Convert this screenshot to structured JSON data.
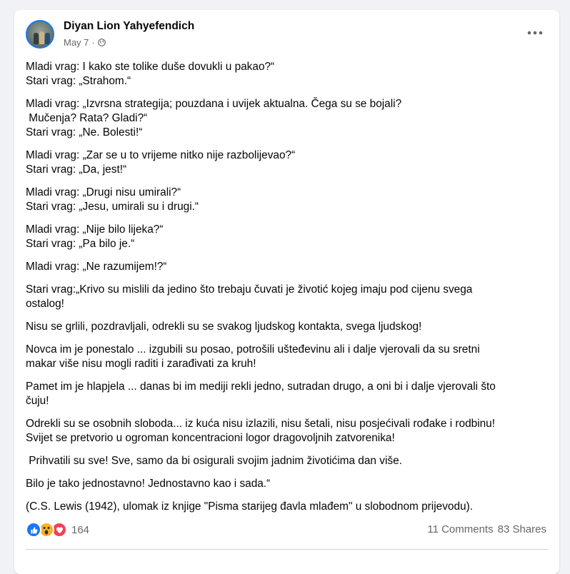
{
  "post": {
    "author": "Diyan Lion Yahyefendich",
    "date": "May 7",
    "separator": "·",
    "paragraphs": [
      "Mladi vrag: I kako ste tolike duše dovukli u pakao?“\nStari vrag: „Strahom.“",
      "Mladi vrag: „Izvrsna strategija; pouzdana i uvijek aktualna. Čega su se bojali?\n Mučenja? Rata? Gladi?“\nStari vrag: „Ne. Bolesti!“",
      "Mladi vrag: „Zar se u to vrijeme nitko nije razbolijevao?“\nStari vrag: „Da, jest!“",
      "Mladi vrag: „Drugi nisu umirali?“\nStari vrag: „Jesu, umirali su i drugi.“",
      "Mladi vrag: „Nije bilo lijeka?“\nStari vrag: „Pa bilo je.“",
      "Mladi vrag: „Ne razumijem!?“",
      "Stari vrag:„Krivo su mislili da jedino što trebaju čuvati je životić kojeg imaju pod cijenu svega\nostalog!",
      "Nisu se grlili, pozdravljali, odrekli su se svakog ljudskog kontakta, svega ljudskog!",
      "Novca im je ponestalo ... izgubili su posao, potrošili ušteđevinu ali i dalje vjerovali da su sretni\nmakar više nisu mogli raditi i zarađivati za kruh!",
      "Pamet im je hlapjela ... danas bi im mediji rekli jedno, sutradan drugo, a oni bi i dalje vjerovali što\nčuju!",
      "Odrekli su se osobnih sloboda... iz kuća nisu izlazili, nisu šetali, nisu posjećivali rođake i rodbinu!\nSvijet se pretvorio u ogroman koncentracioni logor dragovoljnih zatvorenika!",
      " Prihvatili su sve! Sve, samo da bi osigurali svojim jadnim životićima dan više.",
      "Bilo je tako jednostavno! Jednostavno kao i sada.“",
      "(C.S. Lewis (1942), ulomak iz knjige \"Pisma starijeg đavla mlađem\" u slobodnom prijevodu)."
    ]
  },
  "reactions": {
    "icons": [
      "like-icon",
      "wow-icon",
      "love-icon"
    ],
    "count": "164"
  },
  "stats": {
    "comments": "11 Comments",
    "shares": "83 Shares"
  },
  "colors": {
    "accent": "#1877f2",
    "text": "#050505",
    "secondary": "#65676b",
    "like": "#1877f2",
    "wow": "#f7b125",
    "love": "#f33e58"
  }
}
